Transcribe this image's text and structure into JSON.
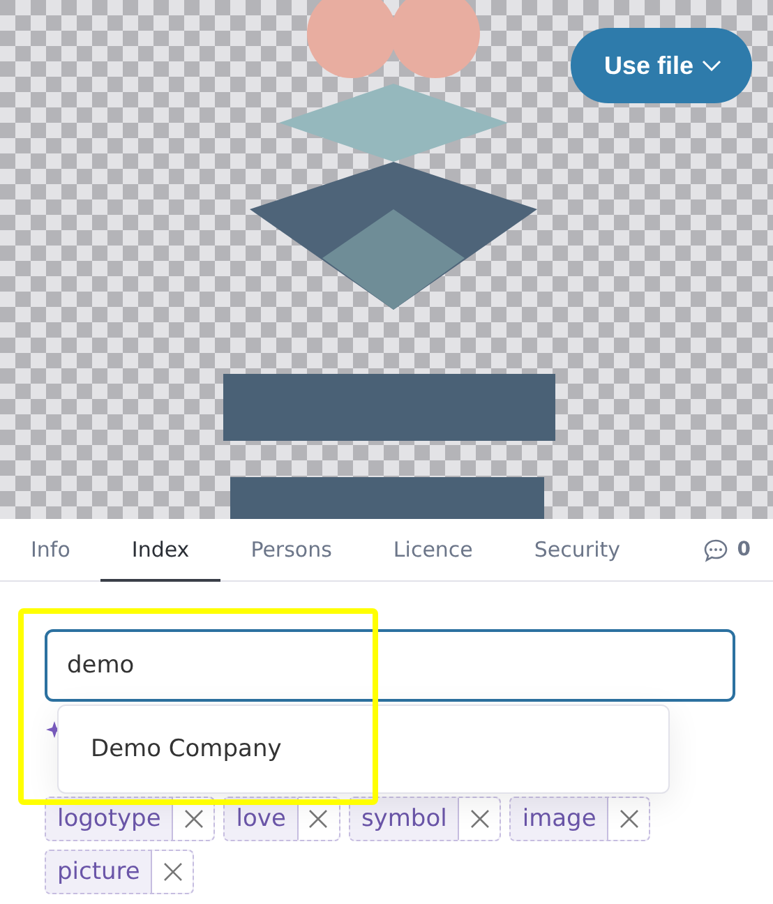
{
  "preview": {
    "kind": "picture",
    "button": {
      "label": "Use file"
    }
  },
  "tabs": [
    {
      "label": "Info",
      "selected": false
    },
    {
      "label": "Index",
      "selected": true
    },
    {
      "label": "Persons",
      "selected": false
    },
    {
      "label": "Licence",
      "selected": false
    },
    {
      "label": "Security",
      "selected": false
    }
  ],
  "comments": {
    "count": "0"
  },
  "search": {
    "value": "demo"
  },
  "suggestions": [
    "Demo Company"
  ],
  "tags": [
    "logotype",
    "love",
    "symbol",
    "image",
    "picture"
  ]
}
